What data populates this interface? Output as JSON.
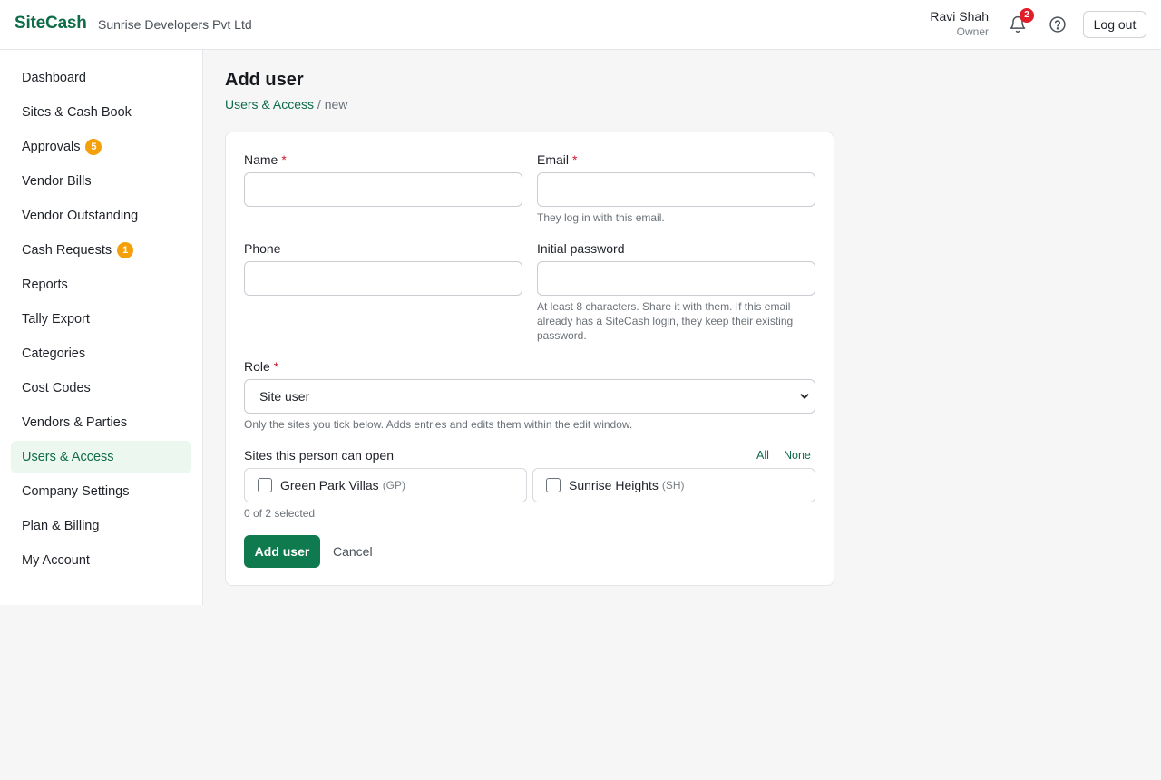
{
  "header": {
    "brand": "SiteCash",
    "company": "Sunrise Developers Pvt Ltd",
    "user_name": "Ravi Shah",
    "user_role": "Owner",
    "notification_count": "2",
    "logout_label": "Log out"
  },
  "sidebar": {
    "items": [
      {
        "label": "Dashboard"
      },
      {
        "label": "Sites & Cash Book"
      },
      {
        "label": "Approvals",
        "badge": "5"
      },
      {
        "label": "Vendor Bills"
      },
      {
        "label": "Vendor Outstanding"
      },
      {
        "label": "Cash Requests",
        "badge": "1"
      },
      {
        "label": "Reports"
      },
      {
        "label": "Tally Export"
      },
      {
        "label": "Categories"
      },
      {
        "label": "Cost Codes"
      },
      {
        "label": "Vendors & Parties"
      },
      {
        "label": "Users & Access",
        "active": true
      },
      {
        "label": "Company Settings"
      },
      {
        "label": "Plan & Billing"
      },
      {
        "label": "My Account"
      }
    ]
  },
  "page": {
    "title": "Add user",
    "breadcrumb_link": "Users & Access",
    "breadcrumb_sep": "/",
    "breadcrumb_current": "new"
  },
  "form": {
    "name_label": "Name",
    "email_label": "Email",
    "email_hint": "They log in with this email.",
    "phone_label": "Phone",
    "password_label": "Initial password",
    "password_hint": "At least 8 characters. Share it with them. If this email already has a SiteCash login, they keep their existing password.",
    "required_mark": "*",
    "name_value": "",
    "email_value": "",
    "phone_value": "",
    "password_value": "",
    "role_label": "Role",
    "role_value": "Site user",
    "role_hint": "Only the sites you tick below. Adds entries and edits them within the edit window.",
    "sites_label": "Sites this person can open",
    "select_all": "All",
    "select_none": "None",
    "sites": [
      {
        "name": "Green Park Villas",
        "code": "(GP)",
        "checked": false
      },
      {
        "name": "Sunrise Heights",
        "code": "(SH)",
        "checked": false
      }
    ],
    "selected_count": "0 of 2 selected",
    "submit_label": "Add user",
    "cancel_label": "Cancel"
  },
  "colors": {
    "brand": "#0f6b48",
    "primary_button": "#0f7a4e",
    "badge_orange": "#f5a00a",
    "badge_red": "#e11d2a",
    "active_nav_bg": "#ecf7f0"
  }
}
